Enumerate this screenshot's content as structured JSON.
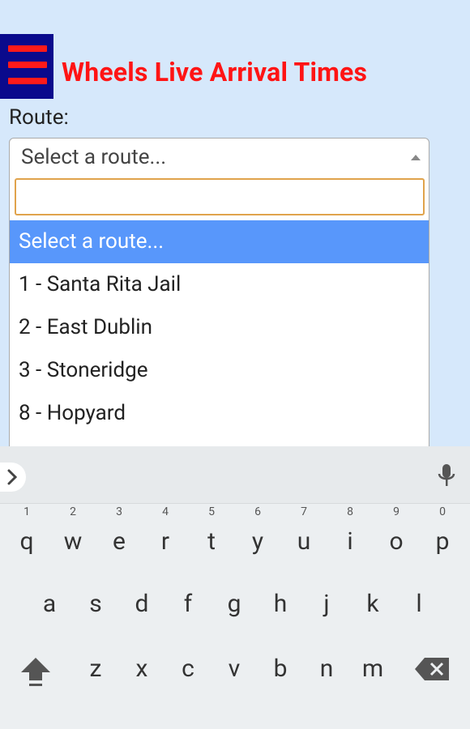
{
  "app": {
    "title": "Wheels Live Arrival Times"
  },
  "form": {
    "route_label": "Route:",
    "select_value": "Select a route...",
    "search_placeholder": ""
  },
  "dropdown": {
    "options": [
      "Select a route...",
      "1 - Santa Rita Jail",
      "2 - East Dublin",
      "3 - Stoneridge",
      "8 - Hopyard"
    ],
    "selected_index": 0
  },
  "keyboard": {
    "row1": [
      {
        "key": "q",
        "hint": "1"
      },
      {
        "key": "w",
        "hint": "2"
      },
      {
        "key": "e",
        "hint": "3"
      },
      {
        "key": "r",
        "hint": "4"
      },
      {
        "key": "t",
        "hint": "5"
      },
      {
        "key": "y",
        "hint": "6"
      },
      {
        "key": "u",
        "hint": "7"
      },
      {
        "key": "i",
        "hint": "8"
      },
      {
        "key": "o",
        "hint": "9"
      },
      {
        "key": "p",
        "hint": "0"
      }
    ],
    "row2": [
      "a",
      "s",
      "d",
      "f",
      "g",
      "h",
      "j",
      "k",
      "l"
    ],
    "row3": [
      "z",
      "x",
      "c",
      "v",
      "b",
      "n",
      "m"
    ]
  },
  "colors": {
    "background": "#d6e8fb",
    "menu_bg": "#0a0a8c",
    "menu_bars": "#ff1a1a",
    "title": "#ff1414",
    "selected_option": "#5897fb",
    "search_border": "#e0a34c"
  },
  "icons": [
    "menu-icon",
    "caret-up-icon",
    "chevron-right-icon",
    "microphone-icon",
    "shift-icon",
    "backspace-icon"
  ]
}
